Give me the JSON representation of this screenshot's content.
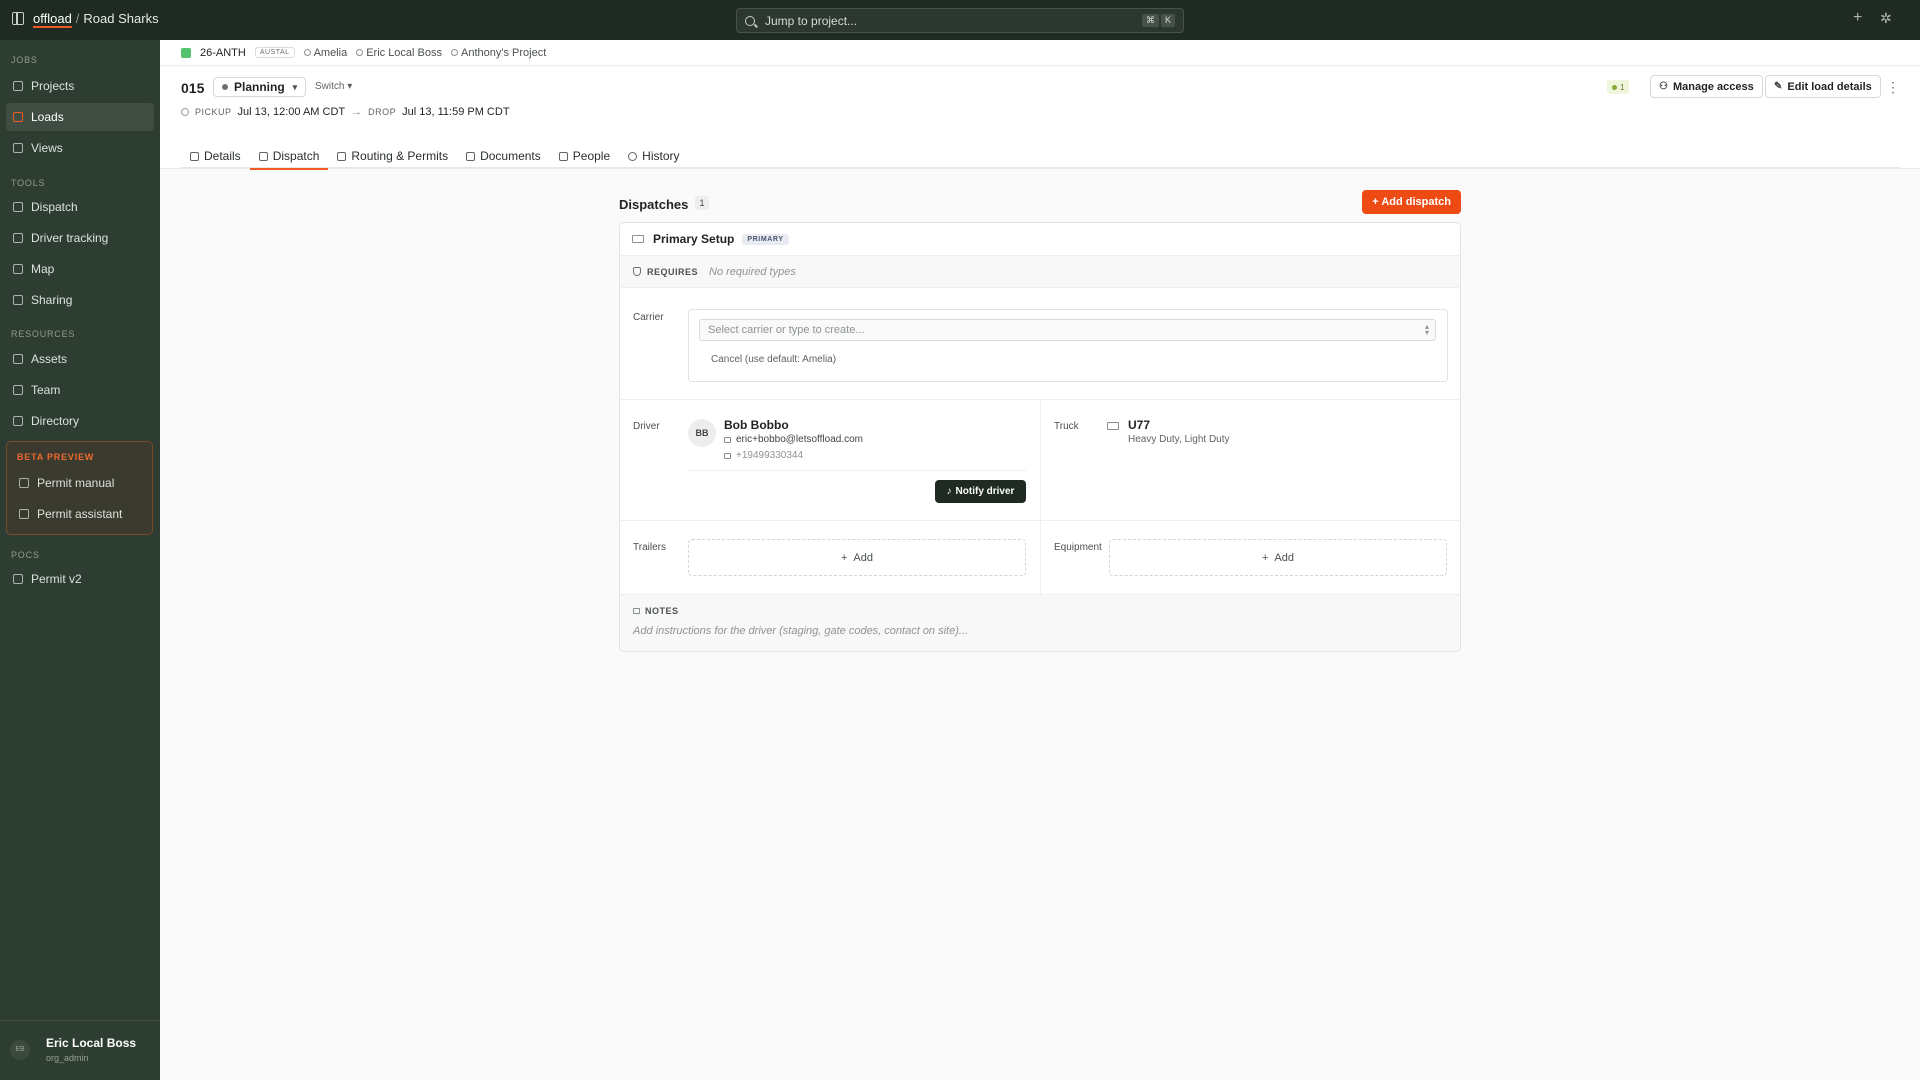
{
  "topbar": {
    "logo": "offload",
    "separator": "/",
    "org": "Road Sharks",
    "search_placeholder": "Jump to project...",
    "shortcut_key1": "⌘",
    "shortcut_key2": "K",
    "plus_glyph": "+",
    "gear_glyph": "✲"
  },
  "sidebar": {
    "jobs_label": "JOBS",
    "jobs": [
      {
        "label": "Projects",
        "icon": "folder-icon"
      },
      {
        "label": "Loads",
        "icon": "truck-icon",
        "active": true
      },
      {
        "label": "Views",
        "icon": "list-icon"
      }
    ],
    "tools_label": "TOOLS",
    "tools": [
      {
        "label": "Dispatch",
        "icon": "dispatch-icon"
      },
      {
        "label": "Driver tracking",
        "icon": "pin-icon"
      },
      {
        "label": "Map",
        "icon": "map-icon"
      },
      {
        "label": "Sharing",
        "icon": "layers-icon"
      }
    ],
    "resources_label": "RESOURCES",
    "resources": [
      {
        "label": "Assets",
        "icon": "box-icon"
      },
      {
        "label": "Team",
        "icon": "users-icon"
      },
      {
        "label": "Directory",
        "icon": "book-icon"
      }
    ],
    "beta_label": "BETA PREVIEW",
    "beta": [
      {
        "label": "Permit manual",
        "icon": "doc-icon"
      },
      {
        "label": "Permit assistant",
        "icon": "sparkle-icon"
      }
    ],
    "pocs_label": "POCS",
    "pocs": [
      {
        "label": "Permit v2",
        "icon": "flag-icon"
      }
    ],
    "user": {
      "initials": "EB",
      "name": "Eric Local Boss",
      "role": "org_admin"
    }
  },
  "breadcrumb": {
    "code": "26-ANTH",
    "tag": "AUSTAL",
    "owner": "Amelia",
    "boss": "Eric Local Boss",
    "project": "Anthony's Project",
    "status_color": "#55c26d"
  },
  "header": {
    "load_no": "015",
    "status": "Planning",
    "switch_label": "Switch",
    "pickup_label": "PICKUP",
    "pickup_time": "Jul 13, 12:00 AM CDT",
    "drop_label": "DROP",
    "drop_time": "Jul 13, 11:59 PM CDT",
    "presence_count": "1",
    "manage_access": "Manage access",
    "edit_load": "Edit load details",
    "more_glyph": "⋮"
  },
  "tabs": [
    {
      "label": "Details"
    },
    {
      "label": "Dispatch",
      "active": true
    },
    {
      "label": "Routing & Permits"
    },
    {
      "label": "Documents"
    },
    {
      "label": "People"
    },
    {
      "label": "History"
    }
  ],
  "dispatches": {
    "title": "Dispatches",
    "count": "1",
    "add_label": "+ Add dispatch",
    "accent": "#ee4b14"
  },
  "card": {
    "name": "Primary Setup",
    "badge": "PRIMARY",
    "requires_label": "REQUIRES",
    "requires_value": "No required types",
    "carrier_label": "Carrier",
    "carrier_placeholder": "Select carrier or type to create...",
    "carrier_cancel": "Cancel (use default: Amelia)",
    "driver_label": "Driver",
    "driver": {
      "initials": "BB",
      "name": "Bob Bobbo",
      "email": "eric+bobbo@letsoffload.com",
      "phone": "+19499330344"
    },
    "notify_label": "Notify driver",
    "truck_label": "Truck",
    "truck": {
      "name": "U77",
      "types": "Heavy Duty, Light Duty"
    },
    "trailers_label": "Trailers",
    "equipment_label": "Equipment",
    "add_label": "Add",
    "notes_label": "NOTES",
    "notes_placeholder": "Add instructions for the driver (staging, gate codes, contact on site)..."
  }
}
